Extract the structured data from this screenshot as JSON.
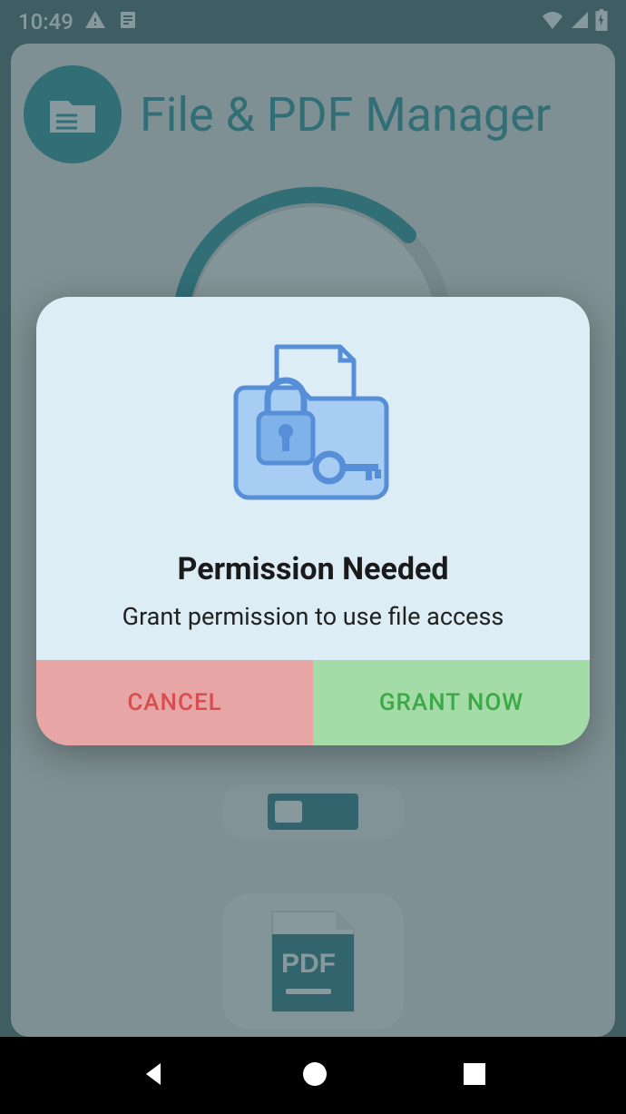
{
  "statusBar": {
    "time": "10:49"
  },
  "app": {
    "title": "File & PDF Manager"
  },
  "dialog": {
    "title": "Permission Needed",
    "message": "Grant permission to use file access",
    "cancelLabel": "CANCEL",
    "grantLabel": "GRANT NOW"
  },
  "pdfLabel": "PDF"
}
